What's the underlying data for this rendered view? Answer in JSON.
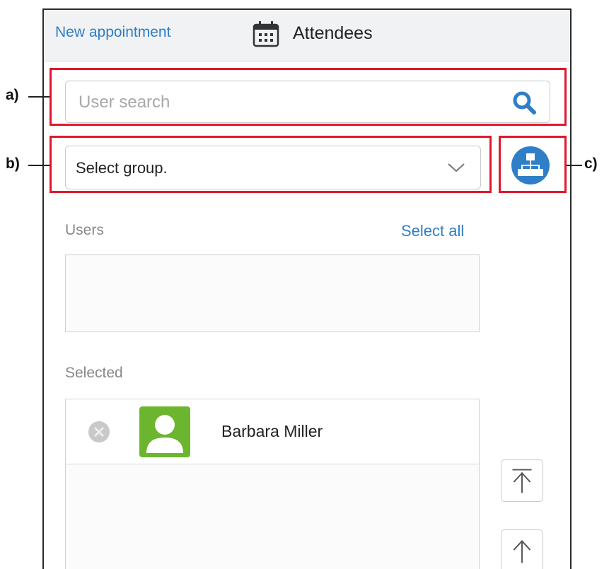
{
  "header": {
    "back_link": "New appointment",
    "title": "Attendees"
  },
  "search": {
    "placeholder": "User search",
    "value": ""
  },
  "group_select": {
    "selected": "Select group."
  },
  "users": {
    "label": "Users",
    "select_all": "Select all"
  },
  "selected": {
    "label": "Selected",
    "items": [
      {
        "name": "Barbara Miller"
      }
    ]
  },
  "callouts": {
    "a": "a)",
    "b": "b)",
    "c": "c)"
  },
  "colors": {
    "link": "#2f7ec8",
    "callout": "#e0182d",
    "avatar_bg": "#6cb52f",
    "org_icon": "#2f7ec8"
  },
  "icons": [
    "calendar-icon",
    "search-icon",
    "chevron-down-icon",
    "org-chart-icon",
    "remove-icon",
    "avatar-icon",
    "move-top-icon",
    "move-up-icon"
  ]
}
